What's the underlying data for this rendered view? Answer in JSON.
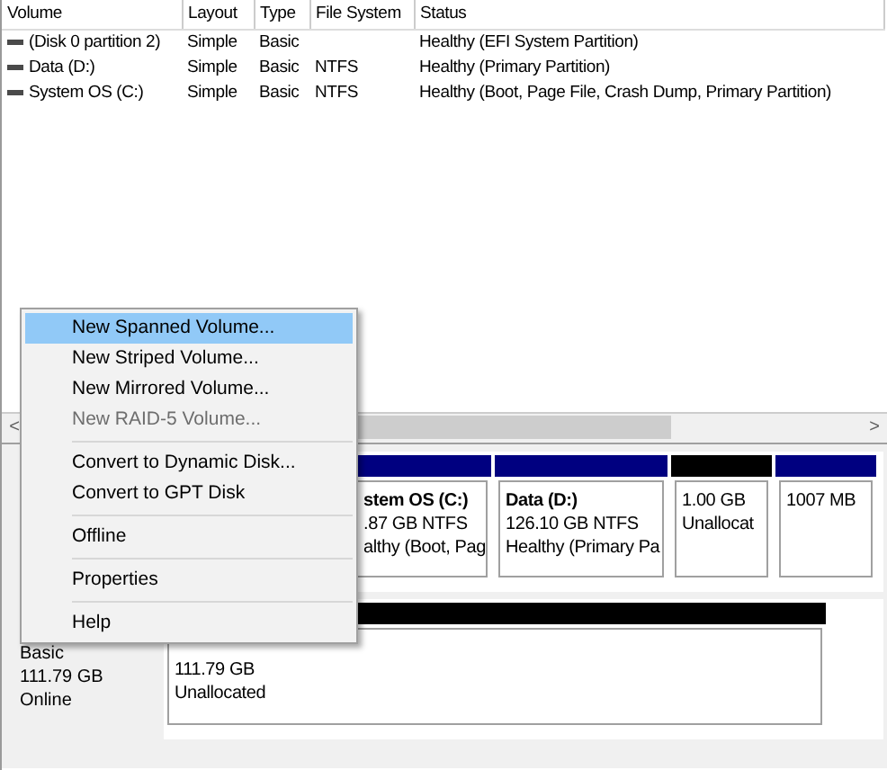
{
  "volumes": {
    "columns": [
      "Volume",
      "Layout",
      "Type",
      "File System",
      "Status"
    ],
    "rows": [
      {
        "cells": [
          "(Disk 0 partition 2)",
          "Simple",
          "Basic",
          "",
          "Healthy (EFI System Partition)"
        ]
      },
      {
        "cells": [
          "Data (D:)",
          "Simple",
          "Basic",
          "NTFS",
          "Healthy (Primary Partition)"
        ]
      },
      {
        "cells": [
          "System OS (C:)",
          "Simple",
          "Basic",
          "NTFS",
          "Healthy (Boot, Page File, Crash Dump, Primary Partition)"
        ]
      }
    ]
  },
  "scrollbar": {
    "left_arrow": "<",
    "right_arrow": ">"
  },
  "disks": [
    {
      "partitions": [
        {
          "color": "#000080",
          "lines": [
            "stem OS  (C:)",
            ".87 GB NTFS",
            "althy (Boot, Pag"
          ]
        },
        {
          "color": "#000080",
          "lines": [
            "Data  (D:)",
            "126.10 GB NTFS",
            "Healthy (Primary Pa"
          ]
        },
        {
          "color": "#000000",
          "lines": [
            "1.00 GB",
            "Unallocat"
          ]
        },
        {
          "color": "#000080",
          "lines": [
            "1007 MB"
          ]
        }
      ]
    },
    {
      "label": [
        "Basic",
        "111.79 GB",
        "Online"
      ],
      "partitions": [
        {
          "color": "#000000",
          "lines": [
            "111.79 GB",
            "Unallocated"
          ]
        }
      ]
    }
  ],
  "context_menu": [
    {
      "kind": "item",
      "label": "New Spanned Volume...",
      "selected": true,
      "disabled": false
    },
    {
      "kind": "item",
      "label": "New Striped Volume...",
      "selected": false,
      "disabled": false
    },
    {
      "kind": "item",
      "label": "New Mirrored Volume...",
      "selected": false,
      "disabled": false
    },
    {
      "kind": "item",
      "label": "New RAID-5 Volume...",
      "selected": false,
      "disabled": true
    },
    {
      "kind": "separator"
    },
    {
      "kind": "item",
      "label": "Convert to Dynamic Disk...",
      "selected": false,
      "disabled": false
    },
    {
      "kind": "item",
      "label": "Convert to GPT Disk",
      "selected": false,
      "disabled": false
    },
    {
      "kind": "separator"
    },
    {
      "kind": "item",
      "label": "Offline",
      "selected": false,
      "disabled": false
    },
    {
      "kind": "separator"
    },
    {
      "kind": "item",
      "label": "Properties",
      "selected": false,
      "disabled": false
    },
    {
      "kind": "separator"
    },
    {
      "kind": "item",
      "label": "Help",
      "selected": false,
      "disabled": false
    }
  ]
}
